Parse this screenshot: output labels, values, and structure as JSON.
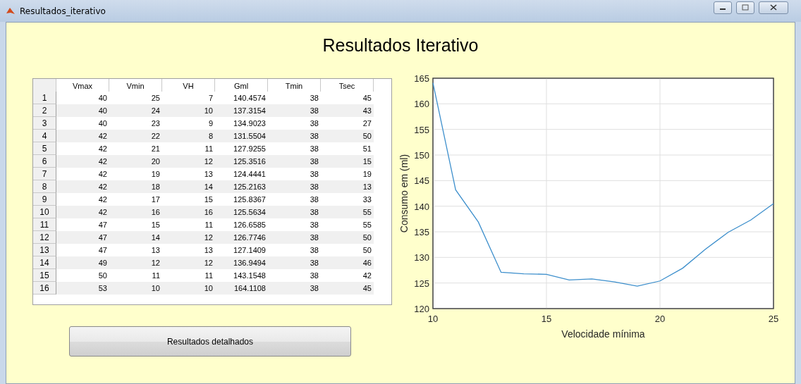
{
  "window": {
    "title": "Resultados_iterativo"
  },
  "heading": "Resultados Iterativo",
  "table": {
    "columns": [
      "Vmax",
      "Vmin",
      "VH",
      "Gml",
      "Tmin",
      "Tsec"
    ],
    "rows": [
      {
        "header": "1",
        "cells": [
          "40",
          "25",
          "7",
          "140.4574",
          "38",
          "45"
        ]
      },
      {
        "header": "2",
        "cells": [
          "40",
          "24",
          "10",
          "137.3154",
          "38",
          "43"
        ]
      },
      {
        "header": "3",
        "cells": [
          "40",
          "23",
          "9",
          "134.9023",
          "38",
          "27"
        ]
      },
      {
        "header": "4",
        "cells": [
          "42",
          "22",
          "8",
          "131.5504",
          "38",
          "50"
        ]
      },
      {
        "header": "5",
        "cells": [
          "42",
          "21",
          "11",
          "127.9255",
          "38",
          "51"
        ]
      },
      {
        "header": "6",
        "cells": [
          "42",
          "20",
          "12",
          "125.3516",
          "38",
          "15"
        ]
      },
      {
        "header": "7",
        "cells": [
          "42",
          "19",
          "13",
          "124.4441",
          "38",
          "19"
        ]
      },
      {
        "header": "8",
        "cells": [
          "42",
          "18",
          "14",
          "125.2163",
          "38",
          "13"
        ]
      },
      {
        "header": "9",
        "cells": [
          "42",
          "17",
          "15",
          "125.8367",
          "38",
          "33"
        ]
      },
      {
        "header": "10",
        "cells": [
          "42",
          "16",
          "16",
          "125.5634",
          "38",
          "55"
        ]
      },
      {
        "header": "11",
        "cells": [
          "47",
          "15",
          "11",
          "126.6585",
          "38",
          "55"
        ]
      },
      {
        "header": "12",
        "cells": [
          "47",
          "14",
          "12",
          "126.7746",
          "38",
          "50"
        ]
      },
      {
        "header": "13",
        "cells": [
          "47",
          "13",
          "13",
          "127.1409",
          "38",
          "50"
        ]
      },
      {
        "header": "14",
        "cells": [
          "49",
          "12",
          "12",
          "136.9494",
          "38",
          "46"
        ]
      },
      {
        "header": "15",
        "cells": [
          "50",
          "11",
          "11",
          "143.1548",
          "38",
          "42"
        ]
      },
      {
        "header": "16",
        "cells": [
          "53",
          "10",
          "10",
          "164.1108",
          "38",
          "45"
        ]
      }
    ]
  },
  "button": "Resultados detalhados",
  "chart_data": {
    "type": "line",
    "xlabel": "Velocidade mínima",
    "ylabel": "Consumo em (ml)",
    "x": [
      10,
      11,
      12,
      13,
      14,
      15,
      16,
      17,
      18,
      19,
      20,
      21,
      22,
      23,
      24,
      25
    ],
    "series": [
      {
        "color": "#3d8fcc",
        "values": [
          164.1,
          143.2,
          136.9,
          127.1,
          126.8,
          126.7,
          125.6,
          125.8,
          125.2,
          124.4,
          125.4,
          127.9,
          131.6,
          134.9,
          137.3,
          140.5
        ]
      }
    ],
    "grid": true,
    "xlim": [
      10,
      25
    ],
    "ylim": [
      120,
      165
    ],
    "xticks": [
      10,
      15,
      20,
      25
    ],
    "yticks": [
      120,
      125,
      130,
      135,
      140,
      145,
      150,
      155,
      160,
      165
    ]
  }
}
